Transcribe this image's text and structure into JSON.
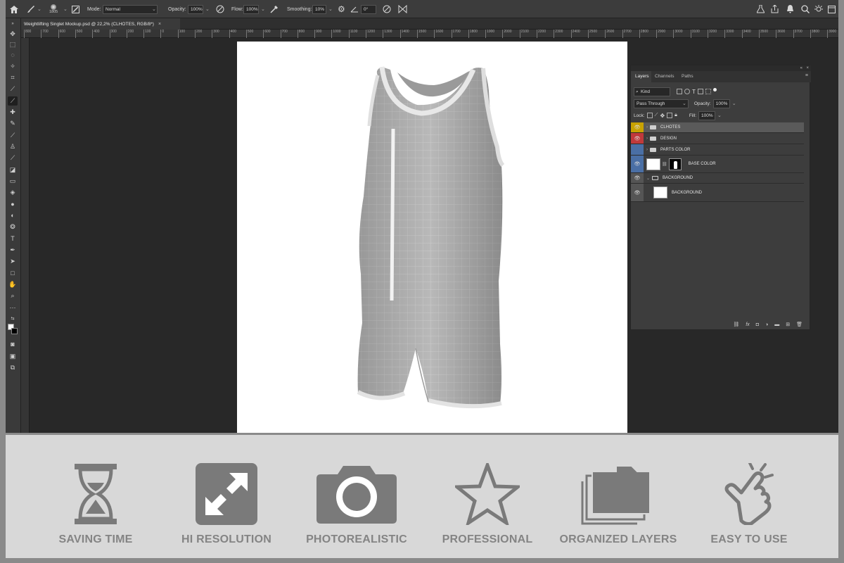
{
  "options_bar": {
    "brush_size": "1805",
    "mode_label": "Mode:",
    "mode_value": "Normal",
    "opacity_label": "Opacity:",
    "opacity_value": "100%",
    "flow_label": "Flow:",
    "flow_value": "100%",
    "smoothing_label": "Smoothing:",
    "smoothing_value": "10%",
    "angle_value": "0°"
  },
  "document_tab": {
    "title": "Weightlifting Singlet Mockup.psd @ 22,2% (CLHOTES, RGB/8*)",
    "close": "×"
  },
  "ruler_ticks": [
    "800",
    "700",
    "600",
    "500",
    "400",
    "300",
    "200",
    "100",
    "0",
    "100",
    "200",
    "300",
    "400",
    "500",
    "600",
    "700",
    "800",
    "900",
    "1000",
    "1100",
    "1200",
    "1300",
    "1400",
    "1500",
    "1600",
    "1700",
    "1800",
    "1900",
    "2000",
    "2100",
    "2200",
    "2300",
    "2400",
    "2500",
    "2600",
    "2700",
    "2800",
    "2900",
    "3000",
    "3100",
    "3200",
    "3300",
    "3400",
    "3500",
    "3600",
    "3700",
    "3800",
    "3900",
    "4000",
    "4100",
    "4200",
    "4300",
    "4400",
    "4500",
    "4600",
    "4700",
    "4800",
    "4900",
    "5000",
    "5100",
    "5200",
    "5300",
    "5400",
    "5500"
  ],
  "layers_panel": {
    "tabs": [
      "Layers",
      "Channels",
      "Paths"
    ],
    "filter_kind": "Kind",
    "blend_mode": "Pass Through",
    "opacity_label": "Opacity:",
    "opacity_value": "100%",
    "lock_label": "Lock:",
    "fill_label": "Fill:",
    "fill_value": "100%",
    "layers": [
      {
        "name": "CLHOTES",
        "type": "group",
        "eye_color": "#c8a200",
        "selected": true
      },
      {
        "name": "DESIGN",
        "type": "group",
        "eye_color": "#c0393b",
        "selected": false
      },
      {
        "name": "PARTS COLOR",
        "type": "group",
        "eye_color": "#4a6fa5",
        "selected": false
      },
      {
        "name": "BASE COLOR",
        "type": "layer-mask",
        "eye_color": "#4a6fa5",
        "selected": false
      },
      {
        "name": "BACKGROUND",
        "type": "group-open",
        "eye_color": "#555555",
        "selected": false
      },
      {
        "name": "BACKGROUND",
        "type": "layer",
        "eye_color": "#555555",
        "selected": false
      }
    ]
  },
  "features": [
    {
      "label": "SAVING TIME",
      "icon": "hourglass-icon"
    },
    {
      "label": "HI RESOLUTION",
      "icon": "expand-arrows-icon"
    },
    {
      "label": "PHOTOREALISTIC",
      "icon": "camera-icon"
    },
    {
      "label": "PROFESSIONAL",
      "icon": "star-icon"
    },
    {
      "label": "ORGANIZED LAYERS",
      "icon": "stacked-layers-icon"
    },
    {
      "label": "EASY TO USE",
      "icon": "tap-hand-icon"
    }
  ],
  "colors": {
    "feature_icon": "#7a7a7a",
    "feature_band": "#d8d8d8",
    "app_bg": "#282828"
  }
}
